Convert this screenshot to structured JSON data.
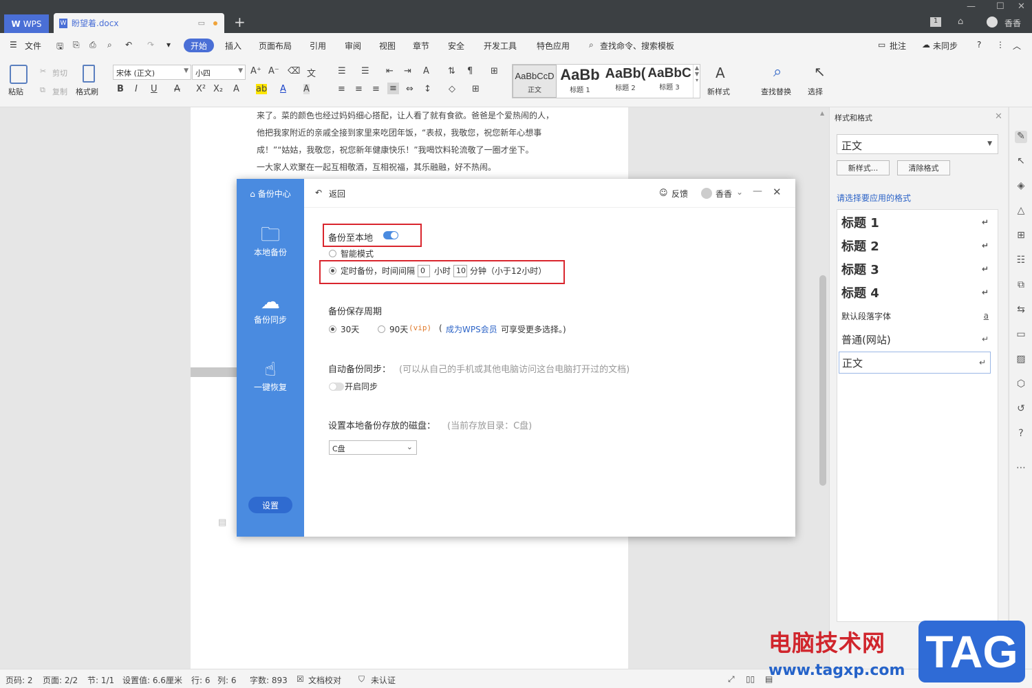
{
  "titlebar": {
    "app_tab": "WPS",
    "doc_tab": "盼望着.docx",
    "user": "香香",
    "badge": "1"
  },
  "menubar": {
    "file": "文件",
    "items": [
      "开始",
      "插入",
      "页面布局",
      "引用",
      "审阅",
      "视图",
      "章节",
      "安全",
      "开发工具",
      "特色应用"
    ],
    "search": "查找命令、搜索模板",
    "comment": "批注",
    "sync": "未同步",
    "help": "?"
  },
  "ribbon": {
    "paste": "粘贴",
    "cut": "剪切",
    "copy": "复制",
    "format_painter": "格式刷",
    "font_name": "宋体 (正文)",
    "font_size": "小四",
    "styles": [
      {
        "preview": "AaBbCcD",
        "name": "正文"
      },
      {
        "preview": "AaBb",
        "name": "标题 1"
      },
      {
        "preview": "AaBb(",
        "name": "标题 2"
      },
      {
        "preview": "AaBbC",
        "name": "标题 3"
      }
    ],
    "new_style": "新样式",
    "find_replace": "查找替换",
    "select": "选择"
  },
  "document": {
    "lines": [
      "来了。菜的颜色也经过妈妈细心搭配，让人看了就有食欲。爸爸是个爱热闹的人，",
      "他把我家附近的亲戚全接到家里来吃团年饭，“表叔，我敬您，祝您新年心想事",
      "成！”“姑姑，我敬您，祝您新年健康快乐！”我喝饮料轮流敬了一圈才坐下。",
      "一大家人欢聚在一起互相敬酒，互相祝福，其乐融融，好不热闹。"
    ]
  },
  "style_pane": {
    "title": "样式和格式",
    "current": "正文",
    "new_style_btn": "新样式...",
    "clear_btn": "清除格式",
    "choose_label": "请选择要应用的格式",
    "items": [
      "标题 1",
      "标题 2",
      "标题 3",
      "标题 4",
      "默认段落字体",
      "普通(网站)",
      "正文"
    ]
  },
  "statusbar": {
    "page_no": "页码: 2",
    "pages": "页面: 2/2",
    "section": "节: 1/1",
    "setting": "设置值: 6.6厘米",
    "row": "行: 6",
    "col": "列: 6",
    "words": "字数: 893",
    "proofread": "文档校对",
    "auth": "未认证"
  },
  "dialog": {
    "brand": "备份中心",
    "back": "返回",
    "feedback": "反馈",
    "user": "香香",
    "side": [
      "本地备份",
      "备份同步",
      "一键恢复"
    ],
    "settings_btn": "设置",
    "backup_local_label": "备份至本地",
    "backup_local_on": true,
    "smart_mode": "智能模式",
    "timed_prefix": "定时备份，时间间隔",
    "hours_value": "0",
    "hours_unit": "小时",
    "minutes_value": "10",
    "minutes_unit": "分钟（小于12小时）",
    "period_label": "备份保存周期",
    "days30": "30天",
    "days90": "90天",
    "vip": "(vip)",
    "paren_open": "(",
    "member_link": "成为WPS会员",
    "more_choice": "可享受更多选择。)",
    "auto_sync_label": "自动备份同步：",
    "auto_sync_hint": "(可以从自己的手机或其他电脑访问这台电脑打开过的文档)",
    "open_sync": "开启同步",
    "disk_label": "设置本地备份存放的磁盘：",
    "disk_hint": "(当前存放目录：C盘)",
    "disk_value": "C盘",
    "accent_color": "#4a8be0",
    "highlight_color": "#d9252d"
  },
  "watermark": {
    "cn": "电脑技术网",
    "url": "www.tagxp.com",
    "tag": "TAG"
  }
}
